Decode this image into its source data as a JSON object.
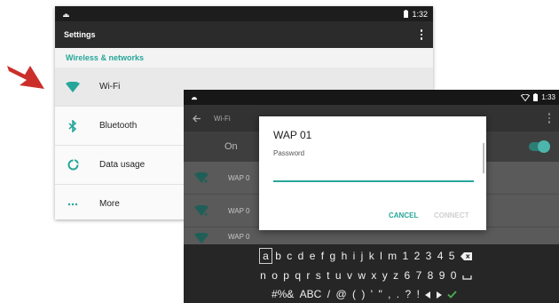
{
  "back": {
    "status_time": "1:32",
    "app_title": "Settings",
    "section_header": "Wireless & networks",
    "items": [
      {
        "label": "Wi-Fi",
        "icon": "wifi-icon"
      },
      {
        "label": "Bluetooth",
        "icon": "bluetooth-icon"
      },
      {
        "label": "Data usage",
        "icon": "data-usage-icon"
      },
      {
        "label": "More",
        "icon": "more-icon"
      }
    ]
  },
  "front": {
    "status_time": "1:33",
    "app_title": "Wi-Fi",
    "on_label": "On",
    "networks": [
      "WAP 0",
      "WAP 0",
      "WAP 0"
    ]
  },
  "dialog": {
    "title": "WAP 01",
    "password_label": "Password",
    "password_value": "",
    "cancel_label": "CANCEL",
    "connect_label": "CONNECT"
  },
  "keyboard": {
    "row1": [
      "a",
      "b",
      "c",
      "d",
      "e",
      "f",
      "g",
      "h",
      "i",
      "j",
      "k",
      "l",
      "m",
      "1",
      "2",
      "3",
      "4",
      "5"
    ],
    "row2": [
      "n",
      "o",
      "p",
      "q",
      "r",
      "s",
      "t",
      "u",
      "v",
      "w",
      "x",
      "y",
      "z",
      "6",
      "7",
      "8",
      "9",
      "0"
    ],
    "row3": [
      "#%&",
      "ABC",
      "/",
      "@",
      "(",
      ")",
      "'",
      "\"",
      ",",
      ".",
      "?",
      "!"
    ]
  },
  "colors": {
    "accent": "#26a69a",
    "pointer_arrow": "#cc2f2a"
  }
}
